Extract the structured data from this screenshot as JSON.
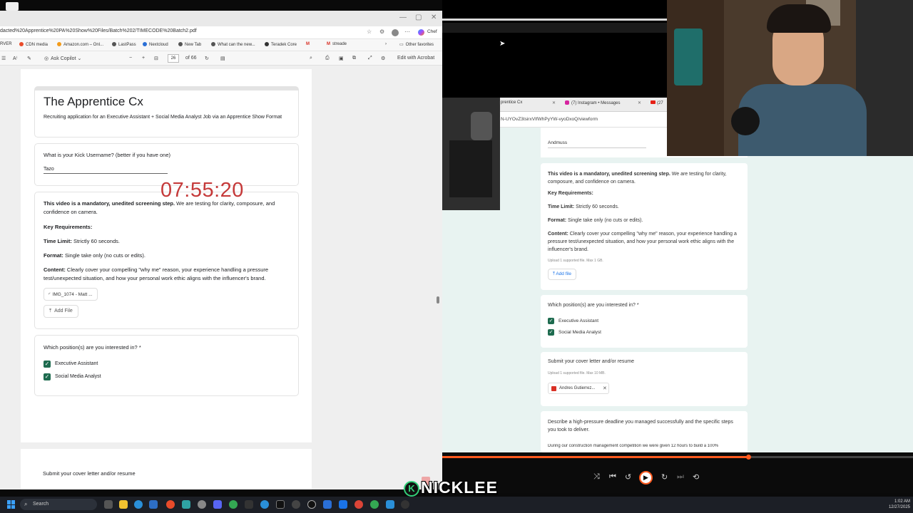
{
  "browser": {
    "url": "dacted%20Apprentice%20PA%20Show%20Files/Batch%202/TIMECODE%20Batch2.pdf",
    "profile_label": "Chef",
    "favorites": [
      "RVER",
      "CDN media",
      "Amazon.com – Onl...",
      "LastPass",
      "Nextcloud",
      "New Tab",
      "What can the new...",
      "Teradek Core",
      "streade",
      "Other favorites"
    ],
    "pdf_toolbar": {
      "ask_copilot": "Ask Copilot",
      "page_current": "26",
      "page_total": "of 66",
      "edit_acrobat": "Edit with Acrobat"
    }
  },
  "pdf_form": {
    "title": "The Apprentice Cx",
    "description": "Recruiting application for an Executive Assistant + Social Media Analyst Job via an Apprentice Show Format",
    "q_kick": "What is your Kick Username? (better if you have one)",
    "kick_answer": "Tazo",
    "video_intro_bold": "This video is a mandatory, unedited screening step.",
    "video_intro_rest": " We are testing for clarity, composure, and confidence on camera.",
    "key_req": "Key Requirements:",
    "time_limit_label": "Time Limit:",
    "time_limit_value": " Strictly 60 seconds.",
    "format_label": "Format:",
    "format_value": " Single take only (no cuts or edits).",
    "content_label": "Content:",
    "content_value": " Clearly cover your compelling \"why me\" reason, your experience handling a pressure test/unexpected situation, and how your personal work ethic aligns with the influencer's brand.",
    "file_chip": "IMG_1074 - Matt ...",
    "add_file": "Add File",
    "q_position": "Which position(s) are you interested in? *",
    "positions": [
      "Executive Assistant",
      "Social Media Analyst"
    ],
    "q_cover": "Submit your cover letter and/or resume"
  },
  "timer": "07:55:20",
  "right_browser": {
    "tabs": [
      "prentice Cx",
      "(7) Instagram • Messages",
      "(27"
    ],
    "url": "N-UYOvZ3tsirxVIfWhPyYW-vyoDxoQ/viewform",
    "name_answer": "Andmuss",
    "video_intro_bold": "This video is a mandatory, unedited screening step.",
    "video_intro_rest": " We are testing for clarity, composure, and confidence on camera.",
    "key_req": "Key Requirements:",
    "time_limit_label": "Time Limit:",
    "time_limit_value": " Strictly 60 seconds.",
    "format_label": "Format:",
    "format_value": " Single take only (no cuts or edits).",
    "content_label": "Content:",
    "content_value": " Clearly cover your compelling \"why me\" reason, your experience handling a pressure test/unexpected situation, and how your personal work ethic aligns with the influencer's brand.",
    "upload_hint": "Upload 1 supported file. Max 1 GB.",
    "add_file": "Add file",
    "q_position": "Which position(s) are you interested in? *",
    "positions": [
      "Executive Assistant",
      "Social Media Analyst"
    ],
    "q_cover": "Submit your cover letter and/or resume",
    "cover_hint": "Upload 1 supported file. Max 10 MB.",
    "cover_file": "Andres Gutierrez...",
    "q_deadline": "Describe a high-pressure deadline you managed successfully and the specific steps you took to deliver.",
    "deadline_answer": "During our construction management competition we were given 12 hours to build a 100%"
  },
  "player": {
    "progress": 0.65
  },
  "taskbar": {
    "search_placeholder": "Search",
    "time": "1:02 AM",
    "date": "12/27/2025"
  },
  "brand": "NICKLEE"
}
